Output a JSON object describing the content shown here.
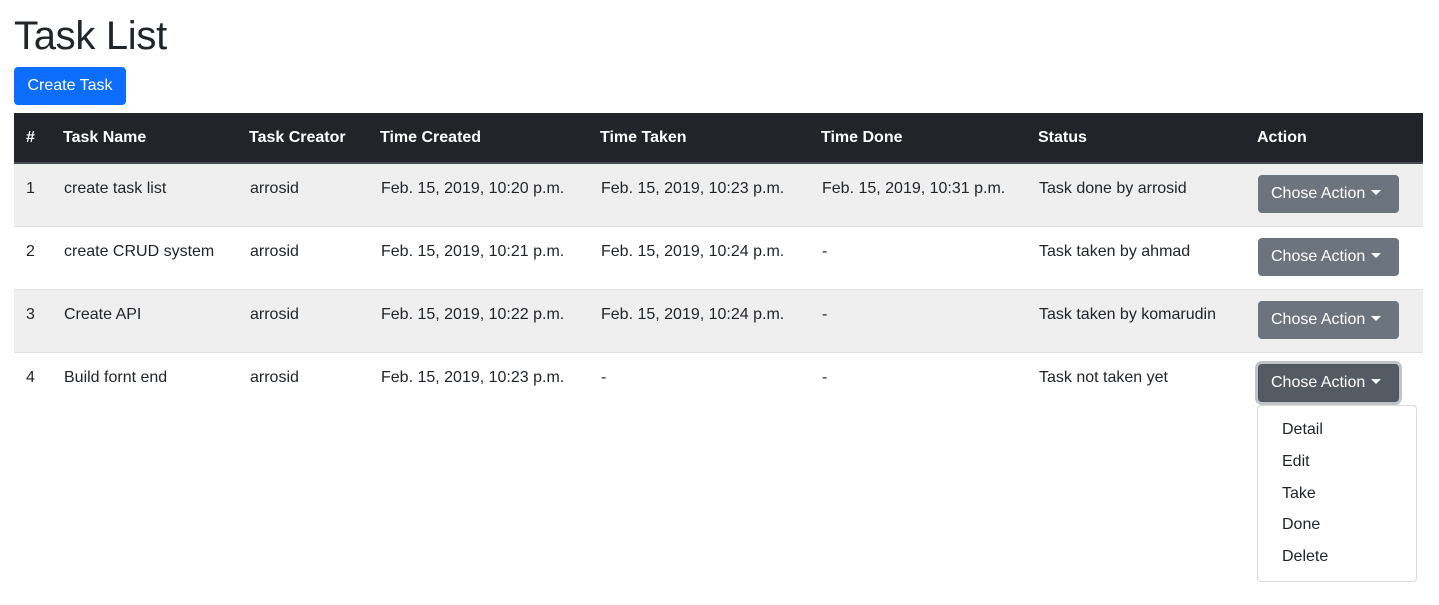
{
  "page": {
    "title": "Task List"
  },
  "toolbar": {
    "create_label": "Create Task"
  },
  "table": {
    "headers": [
      "#",
      "Task Name",
      "Task Creator",
      "Time Created",
      "Time Taken",
      "Time Done",
      "Status",
      "Action"
    ],
    "rows": [
      [
        "1",
        "create task list",
        "arrosid",
        "Feb. 15, 2019, 10:20 p.m.",
        "Feb. 15, 2019, 10:23 p.m.",
        "Feb. 15, 2019, 10:31 p.m.",
        "Task done by arrosid"
      ],
      [
        "2",
        "create CRUD system",
        "arrosid",
        "Feb. 15, 2019, 10:21 p.m.",
        "Feb. 15, 2019, 10:24 p.m.",
        "-",
        "Task taken by ahmad"
      ],
      [
        "3",
        "Create API",
        "arrosid",
        "Feb. 15, 2019, 10:22 p.m.",
        "Feb. 15, 2019, 10:24 p.m.",
        "-",
        "Task taken by komarudin"
      ],
      [
        "4",
        "Build fornt end",
        "arrosid",
        "Feb. 15, 2019, 10:23 p.m.",
        "-",
        "-",
        "Task not taken yet"
      ]
    ],
    "action_label": "Chose Action"
  },
  "dropdown": {
    "items": [
      "Detail",
      "Edit",
      "Take",
      "Done",
      "Delete"
    ]
  },
  "colors": {
    "primary": "#0d6efd",
    "secondary": "#6c757d",
    "header_bg": "#212529"
  }
}
